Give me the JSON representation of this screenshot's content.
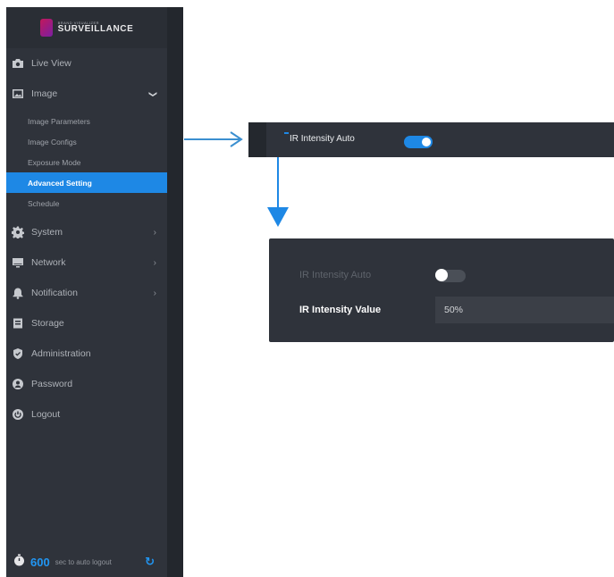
{
  "brand": {
    "small_text": "BRAND VISUALIZER",
    "name": "SURVEILLANCE"
  },
  "sidebar": {
    "items": [
      {
        "label": "Live View",
        "icon": "camera-icon"
      },
      {
        "label": "Image",
        "icon": "image-icon",
        "expanded": true,
        "subitems": [
          {
            "label": "Image Parameters"
          },
          {
            "label": "Image Configs"
          },
          {
            "label": "Exposure Mode"
          },
          {
            "label": "Advanced Setting",
            "active": true
          },
          {
            "label": "Schedule"
          }
        ]
      },
      {
        "label": "System",
        "icon": "gear-icon"
      },
      {
        "label": "Network",
        "icon": "monitor-icon"
      },
      {
        "label": "Notification",
        "icon": "bell-icon"
      },
      {
        "label": "Storage",
        "icon": "storage-icon"
      },
      {
        "label": "Administration",
        "icon": "shield-icon"
      },
      {
        "label": "Password",
        "icon": "user-icon"
      },
      {
        "label": "Logout",
        "icon": "power-icon"
      }
    ],
    "timer": {
      "count": "600",
      "label": "sec to auto logout"
    }
  },
  "before_panel": {
    "ir_auto_label": "IR Intensity Auto",
    "ir_auto_on": true
  },
  "after_panel": {
    "ir_auto_label": "IR Intensity Auto",
    "ir_auto_on": false,
    "ir_value_label": "IR Intensity Value",
    "ir_value": "50%"
  },
  "colors": {
    "accent": "#1e88e5",
    "panel": "#2f333b",
    "arrow": "#3b8fd0"
  }
}
